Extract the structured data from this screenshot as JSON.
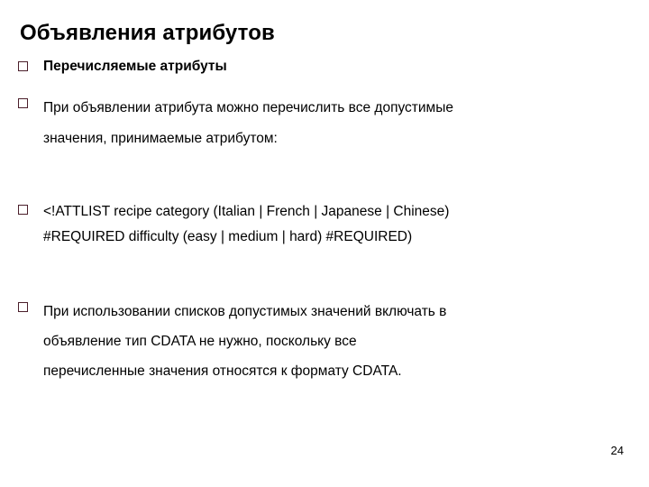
{
  "slide": {
    "title": "Объявления атрибутов",
    "bullet_marker_color": "#4b1f2b",
    "background_color": "#ffffff",
    "text_color": "#000000",
    "page_number": "24",
    "bullets": [
      {
        "marker": "hollow-square-bullet",
        "text": "Перечисляемые атрибуты",
        "emphasis": "bold"
      },
      {
        "marker": "hollow-square-bullet",
        "text": "При объявлении атрибута можно перечислить все допустимые\nзначения, принимаемые атрибутом:",
        "emphasis": "normal"
      },
      {
        "marker": "hollow-square-bullet",
        "text": "<!ATTLIST recipe category (Italian | French | Japanese | Chinese)\n#REQUIRED difficulty (easy | medium | hard) #REQUIRED)",
        "emphasis": "normal"
      },
      {
        "marker": "hollow-square-bullet",
        "text": "При использовании списков допустимых значений включать в\nобъявление тип CDATA не нужно, поскольку все\nперечисленные значения относятся к формату CDATA.",
        "emphasis": "normal"
      }
    ]
  }
}
